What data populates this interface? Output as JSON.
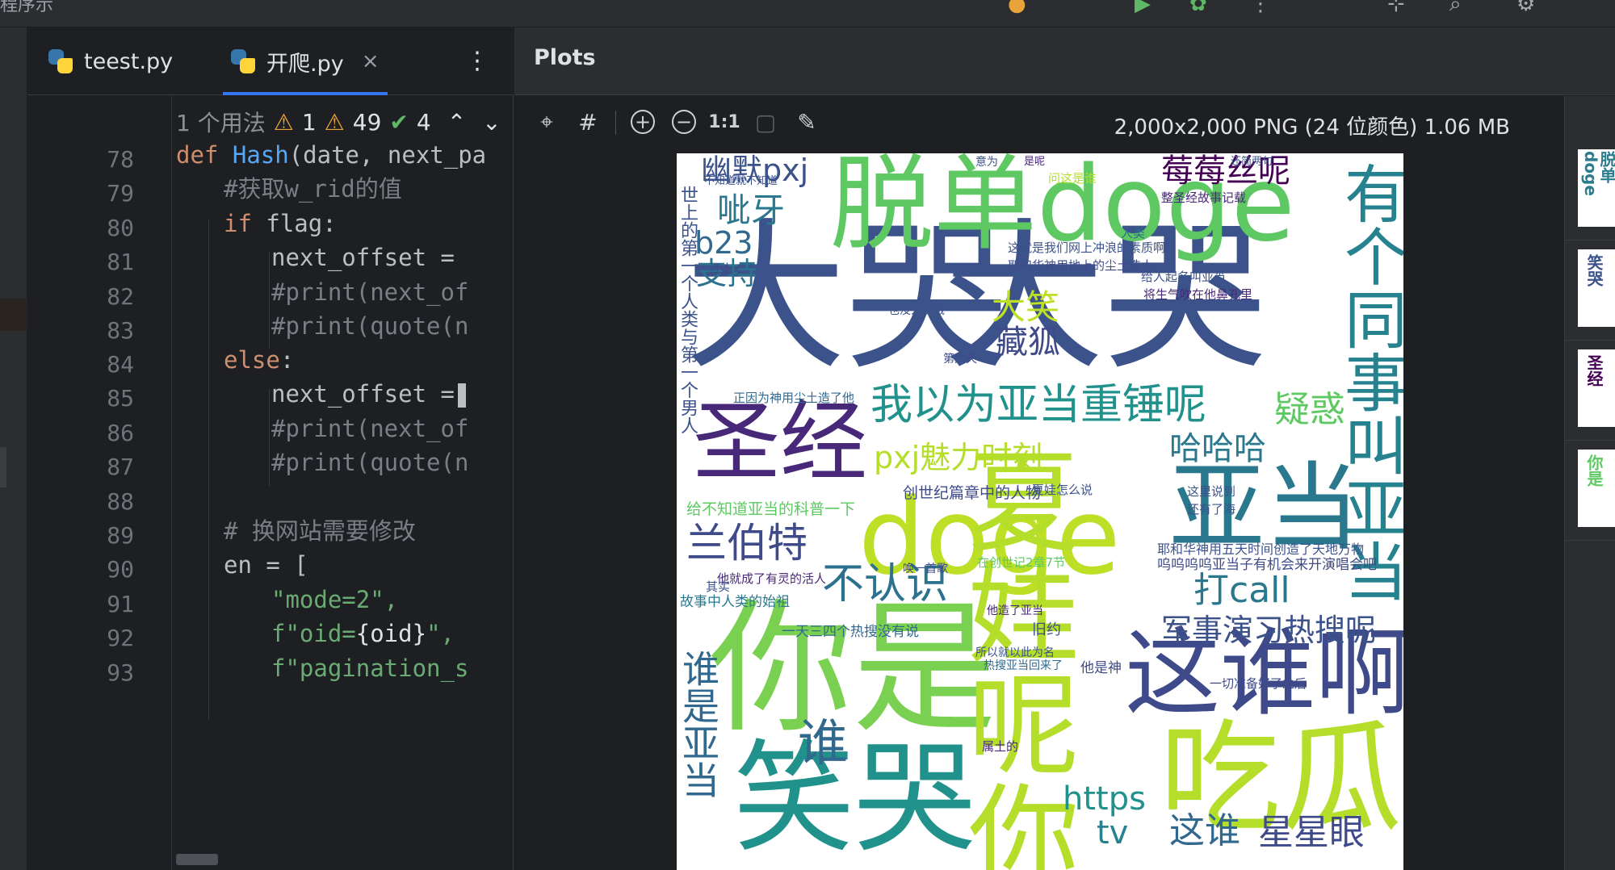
{
  "titlebar": {
    "fragment": "程序示"
  },
  "editor": {
    "tabs": [
      {
        "label": "teest.py"
      },
      {
        "label": "开爬.py",
        "active": true
      }
    ],
    "more_label": "⋮",
    "close_glyph": "×",
    "inlay": {
      "usages": "1 个用法",
      "errors": "1",
      "warnings": "49",
      "ok": "4",
      "up": "⌃",
      "down": "⌄"
    },
    "line_numbers": [
      "78",
      "79",
      "80",
      "81",
      "82",
      "83",
      "84",
      "85",
      "86",
      "87",
      "88",
      "89",
      "90",
      "91",
      "92",
      "93"
    ],
    "code": {
      "l78_def": "def",
      "l78_fn": "Hash",
      "l78_rest": "(date, next_pa",
      "l79": "#获取w_rid的值",
      "l80_kw": "if",
      "l80_rest": " flag:",
      "l81": "next_offset =",
      "l82": "#print(next_of",
      "l83": "#print(quote(n",
      "l84_kw": "else",
      "l84_rest": ":",
      "l85": "next_offset =",
      "l86": "#print(next_of",
      "l87": "#print(quote(n",
      "l89": "# 换网站需要修改",
      "l90": "en = [",
      "l91": "\"mode=2\",",
      "l92_pre": "f\"oid=",
      "l92_var": "{oid}",
      "l92_post": "\",",
      "l93": "f\"pagination_s"
    }
  },
  "plots": {
    "title": "Plots",
    "toolbar": {
      "fit_icon": "fit-to-window-icon",
      "grid_icon": "grid-icon",
      "zoom_in": "+",
      "zoom_out": "−",
      "actual_size": "1:1",
      "picker_icon": "color-picker-icon"
    },
    "image_info": "2,000x2,000 PNG (24 位颜色) 1.06 MB",
    "thumbnails": [
      "脱单doge",
      "笑哭",
      "圣经",
      "你是"
    ]
  },
  "wordcloud": {
    "big": [
      "大哭",
      "大哭",
      "脱单doge",
      "你是",
      "笑哭",
      "doge",
      "谁",
      "亚当",
      "圣经",
      "这谁啊",
      "吃瓜",
      "夏娃呢你",
      "有个同事叫亚当"
    ],
    "medium": [
      "幽默pxj",
      "莓莓丝呢",
      "呲牙",
      "b23",
      "支持",
      "大笑",
      "藏狐",
      "我以为亚当重锤呢",
      "疑惑",
      "哈哈哈",
      "pxj魅力时刻",
      "兰伯特",
      "不认识",
      "打call",
      "军事演习热搜呢",
      "谁是亚当",
      "https",
      "tv",
      "这谁",
      "星星眼",
      "世上的第一个人类与第一个男人"
    ],
    "small": [
      "创世纪篇章中的人物",
      "给不知道亚当的科普一下",
      "他就成了有灵的活人",
      "故事中人类的始祖",
      "正因为神用尘土造了他",
      "耶和华神用五天时间创造了天地万物",
      "呜呜呜呜亚当子有机会来开演唱会吧",
      "这就是我们网上冲浪的素质啊",
      "耶和华神用地上的尘土造人",
      "给人起名叫亚当",
      "将生气吹在他鼻孔里",
      "一天三四个热搜没有说",
      "他是神",
      "旧约",
      "属土的",
      "第六天",
      "红土",
      "其实",
      "问这是谁",
      "还简两句",
      "人类",
      "整圣经故事记载",
      "不知道就不知道",
      "这里说到",
      "还有了海",
      "夏娃怎么说",
      "一切准备好了之后",
      "所以就以此为名",
      "热搜亚当回来了",
      "在创世记2章7节",
      "他造了亚当",
      "意为",
      "是呢",
      "唤一首歌",
      "也没人说哦"
    ]
  }
}
